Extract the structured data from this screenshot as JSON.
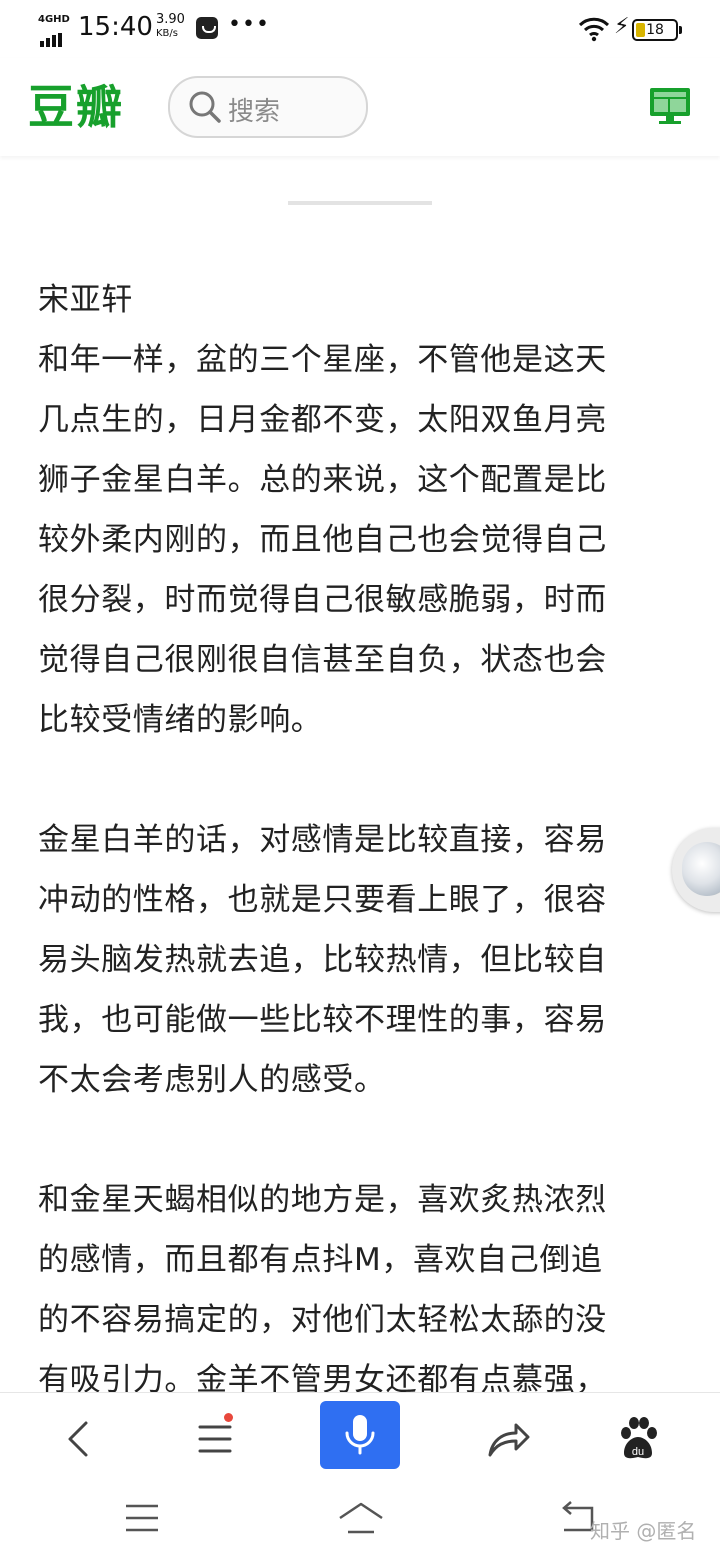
{
  "status_bar": {
    "network": "4GHD",
    "time": "15:40",
    "speed_value": "3.90",
    "speed_unit": "KB/s",
    "more": "•••",
    "battery": "18"
  },
  "header": {
    "logo": "豆瓣",
    "search_placeholder": "搜索",
    "icons": {
      "search": "search-icon",
      "desktop": "desktop-mode-icon"
    },
    "brand_color": "#17a02c"
  },
  "article": {
    "paragraphs": [
      [
        "宋亚轩",
        "和年一样，盆的三个星座，不管他是这天",
        "几点生的，日月金都不变，太阳双鱼月亮",
        "狮子金星白羊。总的来说，这个配置是比",
        "较外柔内刚的，而且他自己也会觉得自己",
        "很分裂，时而觉得自己很敏感脆弱，时而",
        "觉得自己很刚很自信甚至自负，状态也会",
        "比较受情绪的影响。"
      ],
      [
        "金星白羊的话，对感情是比较直接，容易",
        "冲动的性格，也就是只要看上眼了，很容",
        "易头脑发热就去追，比较热情，但比较自",
        "我，也可能做一些比较不理性的事，容易",
        "不太会考虑别人的感受。"
      ],
      [
        "和金星天蝎相似的地方是，喜欢炙热浓烈",
        "的感情，而且都有点抖M，喜欢自己倒追",
        "的不容易搞定的，对他们太轻松太舔的没",
        "有吸引力。金羊不管男女还都有点慕强，"
      ]
    ]
  },
  "toolbar": {
    "icons": [
      "back-icon",
      "menu-icon",
      "microphone-icon",
      "share-icon",
      "baidu-paw-icon"
    ],
    "mic_color": "#2f6ff2"
  },
  "navbar": {
    "icons": [
      "recent-apps-icon",
      "home-icon",
      "back-icon"
    ]
  },
  "watermark": "知乎 @匿名"
}
